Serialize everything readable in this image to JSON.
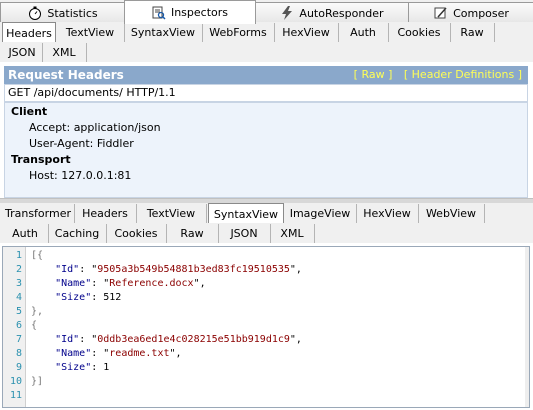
{
  "top_tabs": [
    {
      "label": "Statistics",
      "icon": "stopwatch-icon"
    },
    {
      "label": "Inspectors",
      "icon": "inspectors-icon"
    },
    {
      "label": "AutoResponder",
      "icon": "lightning-icon"
    },
    {
      "label": "Composer",
      "icon": "composer-icon"
    }
  ],
  "request_tabs_row1": [
    "Headers",
    "TextView",
    "SyntaxView",
    "WebForms",
    "HexView",
    "Auth",
    "Cookies",
    "Raw"
  ],
  "request_tabs_row2": [
    "JSON",
    "XML"
  ],
  "request_headers": {
    "title": "Request Headers",
    "link_raw": "[ Raw ]",
    "link_defs": "[ Header Definitions ]",
    "request_line": "GET /api/documents/ HTTP/1.1",
    "groups": [
      {
        "name": "Client",
        "headers": [
          "Accept: application/json",
          "User-Agent: Fiddler"
        ]
      },
      {
        "name": "Transport",
        "headers": [
          "Host: 127.0.0.1:81"
        ]
      }
    ]
  },
  "response_tabs_row1": [
    "Transformer",
    "Headers",
    "TextView",
    "SyntaxView",
    "ImageView",
    "HexView",
    "WebView"
  ],
  "response_tabs_row2": [
    "Auth",
    "Caching",
    "Cookies",
    "Raw",
    "JSON",
    "XML"
  ],
  "code": {
    "line_numbers": [
      "1",
      "2",
      "3",
      "4",
      "5",
      "6",
      "7",
      "8",
      "9",
      "10",
      "11"
    ],
    "documents": [
      {
        "Id": "9505a3b549b54881b3ed83fc19510535",
        "Name": "Reference.docx",
        "Size": "512"
      },
      {
        "Id": "0ddb3ea6ed1e4c028215e51bb919d1c9",
        "Name": "readme.txt",
        "Size": "1"
      }
    ],
    "keys": {
      "id": "\"Id\"",
      "name": "\"Name\"",
      "size": "\"Size\""
    }
  },
  "colors": {
    "title_bar": "#8aa8cb",
    "links": "#ffff55",
    "panel_bg": "#edf3fb"
  }
}
